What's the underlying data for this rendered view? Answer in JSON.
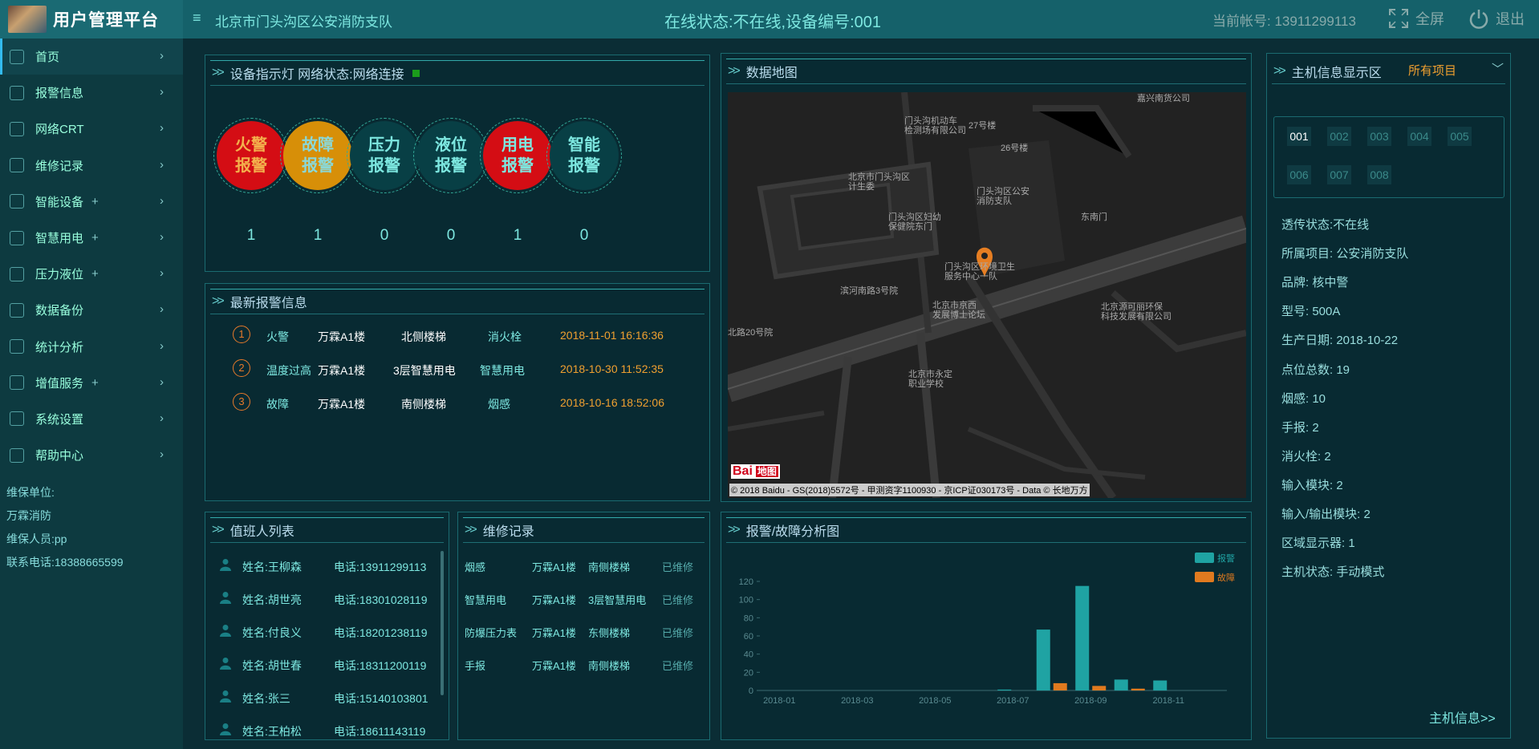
{
  "header": {
    "title": "用户管理平台",
    "unit_name": "北京市门头沟区公安消防支队",
    "online_status": "在线状态:不在线,设备编号:001",
    "account": "当前帐号: 13911299113",
    "fullscreen_label": "全屏",
    "logout_label": "退出"
  },
  "sidebar": {
    "items": [
      {
        "label": "首页",
        "plus": ""
      },
      {
        "label": "报警信息",
        "plus": ""
      },
      {
        "label": "网络CRT",
        "plus": ""
      },
      {
        "label": "维修记录",
        "plus": ""
      },
      {
        "label": "智能设备",
        "plus": "+"
      },
      {
        "label": "智慧用电",
        "plus": "+"
      },
      {
        "label": "压力液位",
        "plus": "+"
      },
      {
        "label": "数据备份",
        "plus": ""
      },
      {
        "label": "统计分析",
        "plus": ""
      },
      {
        "label": "增值服务",
        "plus": "+"
      },
      {
        "label": "系统设置",
        "plus": ""
      },
      {
        "label": "帮助中心",
        "plus": ""
      }
    ],
    "maint_unit_label": "维保单位:",
    "maint_unit": "万霖消防",
    "maint_person": "维保人员:pp",
    "maint_phone": "联系电话:18388665599"
  },
  "indicator": {
    "title": "设备指示灯 网络状态:网络连接",
    "alarms": [
      {
        "line1": "火警",
        "line2": "报警",
        "count": "1",
        "color": "#d40d14",
        "text_color": "#f3b04c"
      },
      {
        "line1": "故障",
        "line2": "报警",
        "count": "1",
        "color": "#d78f08",
        "text_color": "#8ad8d8"
      },
      {
        "line1": "压力",
        "line2": "报警",
        "count": "0",
        "color": "#083f45",
        "text_color": "#7de7e0"
      },
      {
        "line1": "液位",
        "line2": "报警",
        "count": "0",
        "color": "#083f45",
        "text_color": "#7de7e0"
      },
      {
        "line1": "用电",
        "line2": "报警",
        "count": "1",
        "color": "#d40d14",
        "text_color": "#7de7e0"
      },
      {
        "line1": "智能",
        "line2": "报警",
        "count": "0",
        "color": "#083f45",
        "text_color": "#7de7e0"
      }
    ]
  },
  "latest": {
    "title": "最新报警信息",
    "rows": [
      {
        "num": "1",
        "type": "火警",
        "building": "万霖A1楼",
        "location": "北侧楼梯",
        "device": "消火栓",
        "time": "2018-11-01 16:16:36"
      },
      {
        "num": "2",
        "type": "温度过高",
        "building": "万霖A1楼",
        "location": "3层智慧用电",
        "device": "智慧用电",
        "time": "2018-10-30 11:52:35"
      },
      {
        "num": "3",
        "type": "故障",
        "building": "万霖A1楼",
        "location": "南侧楼梯",
        "device": "烟感",
        "time": "2018-10-16 18:52:06"
      }
    ]
  },
  "map": {
    "title": "数据地图",
    "labels": [
      "嘉兴南货公司",
      "门头沟机动车",
      "检测场有限公司",
      "27号楼",
      "26号楼",
      "北京市门头沟区",
      "计生委",
      "门头沟区公安",
      "消防支队",
      "门头沟区妇幼",
      "保健院东门",
      "东南门",
      "门头沟区环境卫生",
      "服务中心一队",
      "滨河南路3号院",
      "北京市京西",
      "发展博士论坛",
      "北京源可丽环保",
      "科技发展有限公司",
      "北路20号院",
      "北京市永定",
      "职业学校"
    ],
    "copyright": "© 2018 Baidu - GS(2018)5572号 - 甲测资字1100930 - 京ICP证030173号 - Data © 长地万方",
    "logo_text": "Bai",
    "logo_text2": "地图"
  },
  "host": {
    "title": "主机信息显示区",
    "project_select": "所有项目",
    "tabs": [
      "001",
      "002",
      "003",
      "004",
      "005",
      "006",
      "007",
      "008"
    ],
    "info": [
      "透传状态:不在线",
      "所属项目: 公安消防支队",
      "品牌: 核中警",
      "型号: 500A",
      "生产日期: 2018-10-22",
      "点位总数: 19",
      "烟感: 10",
      "手报: 2",
      "消火栓: 2",
      "输入模块: 2",
      "输入/输出模块: 2",
      "区域显示器: 1",
      "主机状态: 手动模式"
    ],
    "more_link": "主机信息>>"
  },
  "duty": {
    "title": "值班人列表",
    "rows": [
      {
        "name": "姓名:王柳森",
        "phone": "电话:13911299113"
      },
      {
        "name": "姓名:胡世亮",
        "phone": "电话:18301028119"
      },
      {
        "name": "姓名:付良义",
        "phone": "电话:18201238119"
      },
      {
        "name": "姓名:胡世春",
        "phone": "电话:18311200119"
      },
      {
        "name": "姓名:张三",
        "phone": "电话:15140103801"
      },
      {
        "name": "姓名:王柏松",
        "phone": "电话:18611143119"
      }
    ]
  },
  "repair": {
    "title": "维修记录",
    "rows": [
      {
        "device": "烟感",
        "building": "万霖A1楼",
        "location": "南侧楼梯",
        "status": "已维修"
      },
      {
        "device": "智慧用电",
        "building": "万霖A1楼",
        "location": "3层智慧用电",
        "status": "已维修"
      },
      {
        "device": "防爆压力表",
        "building": "万霖A1楼",
        "location": "东侧楼梯",
        "status": "已维修"
      },
      {
        "device": "手报",
        "building": "万霖A1楼",
        "location": "南侧楼梯",
        "status": "已维修"
      }
    ]
  },
  "analysis": {
    "title": "报警/故障分析图"
  },
  "chart_data": {
    "type": "bar",
    "title": "",
    "categories": [
      "2018-01",
      "2018-02",
      "2018-03",
      "2018-04",
      "2018-05",
      "2018-06",
      "2018-07",
      "2018-08",
      "2018-09",
      "2018-10",
      "2018-11",
      "2018-12"
    ],
    "x_tick_labels": [
      "2018-01",
      "2018-03",
      "2018-05",
      "2018-07",
      "2018-09",
      "2018-11"
    ],
    "series": [
      {
        "name": "报警",
        "color": "#1fa3a3",
        "values": [
          0,
          0,
          0,
          0,
          0,
          0,
          1,
          67,
          115,
          12,
          11,
          0
        ]
      },
      {
        "name": "故障",
        "color": "#e07a1f",
        "values": [
          0,
          0,
          0,
          0,
          0,
          0,
          0,
          8,
          5,
          2,
          0,
          0
        ]
      }
    ],
    "ylim": [
      0,
      120
    ],
    "y_ticks": [
      0,
      20,
      40,
      60,
      80,
      100,
      120
    ],
    "legend": "top-right",
    "grid": false
  }
}
